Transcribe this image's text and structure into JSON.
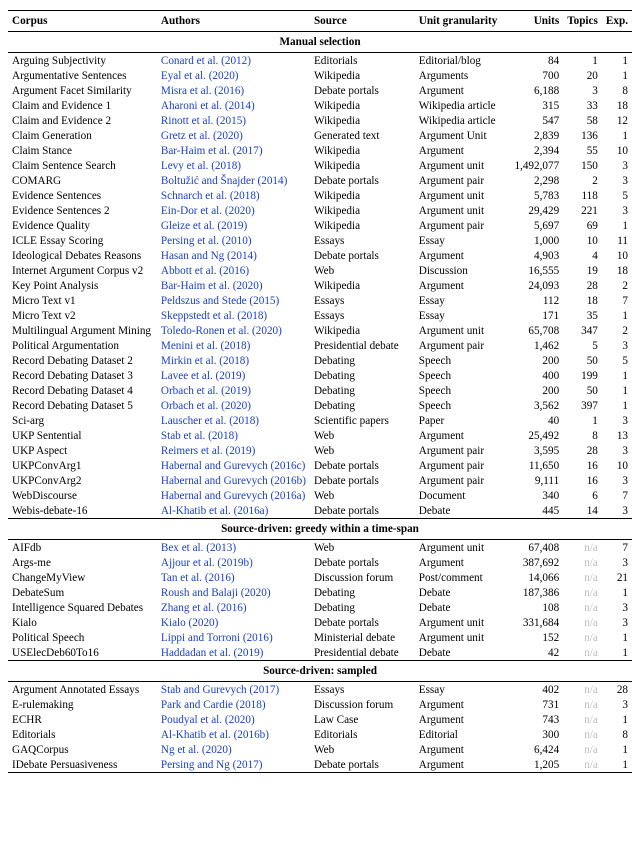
{
  "headers": {
    "corpus": "Corpus",
    "authors": "Authors",
    "source": "Source",
    "granularity": "Unit granularity",
    "units": "Units",
    "topics": "Topics",
    "exp": "Exp."
  },
  "sections": [
    {
      "title": "Manual selection",
      "rows": [
        {
          "corpus": "Arguing Subjectivity",
          "authors": "Conard et al. (2012)",
          "source": "Editorials",
          "gran": "Editorial/blog",
          "units": "84",
          "topics": "1",
          "exp": "1"
        },
        {
          "corpus": "Argumentative Sentences",
          "authors": "Eyal et al. (2020)",
          "source": "Wikipedia",
          "gran": "Arguments",
          "units": "700",
          "topics": "20",
          "exp": "1"
        },
        {
          "corpus": "Argument Facet Similarity",
          "authors": "Misra et al. (2016)",
          "source": "Debate portals",
          "gran": "Argument",
          "units": "6,188",
          "topics": "3",
          "exp": "8"
        },
        {
          "corpus": "Claim and Evidence 1",
          "authors": "Aharoni et al. (2014)",
          "source": "Wikipedia",
          "gran": "Wikipedia article",
          "units": "315",
          "topics": "33",
          "exp": "18"
        },
        {
          "corpus": "Claim and Evidence 2",
          "authors": "Rinott et al. (2015)",
          "source": "Wikipedia",
          "gran": "Wikipedia article",
          "units": "547",
          "topics": "58",
          "exp": "12"
        },
        {
          "corpus": "Claim Generation",
          "authors": "Gretz et al. (2020)",
          "source": "Generated text",
          "gran": "Argument Unit",
          "units": "2,839",
          "topics": "136",
          "exp": "1"
        },
        {
          "corpus": "Claim Stance",
          "authors": "Bar-Haim et al. (2017)",
          "source": "Wikipedia",
          "gran": "Argument",
          "units": "2,394",
          "topics": "55",
          "exp": "10"
        },
        {
          "corpus": "Claim Sentence Search",
          "authors": "Levy et al. (2018)",
          "source": "Wikipedia",
          "gran": "Argument unit",
          "units": "1,492,077",
          "topics": "150",
          "exp": "3"
        },
        {
          "corpus": "COMARG",
          "authors": "Boltužić and Šnajder (2014)",
          "source": "Debate portals",
          "gran": "Argument pair",
          "units": "2,298",
          "topics": "2",
          "exp": "3"
        },
        {
          "corpus": "Evidence Sentences",
          "authors": "Schnarch et al. (2018)",
          "source": "Wikipedia",
          "gran": "Argument unit",
          "units": "5,783",
          "topics": "118",
          "exp": "5"
        },
        {
          "corpus": "Evidence Sentences 2",
          "authors": "Ein-Dor et al. (2020)",
          "source": "Wikipedia",
          "gran": "Argument unit",
          "units": "29,429",
          "topics": "221",
          "exp": "3"
        },
        {
          "corpus": "Evidence Quality",
          "authors": "Gleize et al. (2019)",
          "source": "Wikipedia",
          "gran": "Argument pair",
          "units": "5,697",
          "topics": "69",
          "exp": "1"
        },
        {
          "corpus": "ICLE Essay Scoring",
          "authors": "Persing et al. (2010)",
          "source": "Essays",
          "gran": "Essay",
          "units": "1,000",
          "topics": "10",
          "exp": "11"
        },
        {
          "corpus": "Ideological Debates Reasons",
          "authors": "Hasan and Ng (2014)",
          "source": "Debate portals",
          "gran": "Argument",
          "units": "4,903",
          "topics": "4",
          "exp": "10"
        },
        {
          "corpus": "Internet Argument Corpus v2",
          "authors": "Abbott et al. (2016)",
          "source": "Web",
          "gran": "Discussion",
          "units": "16,555",
          "topics": "19",
          "exp": "18"
        },
        {
          "corpus": "Key Point Analysis",
          "authors": "Bar-Haim et al. (2020)",
          "source": "Wikipedia",
          "gran": "Argument",
          "units": "24,093",
          "topics": "28",
          "exp": "2"
        },
        {
          "corpus": "Micro Text v1",
          "authors": "Peldszus and Stede (2015)",
          "source": "Essays",
          "gran": "Essay",
          "units": "112",
          "topics": "18",
          "exp": "7"
        },
        {
          "corpus": "Micro Text v2",
          "authors": "Skeppstedt et al. (2018)",
          "source": "Essays",
          "gran": "Essay",
          "units": "171",
          "topics": "35",
          "exp": "1"
        },
        {
          "corpus": "Multilingual Argument Mining",
          "authors": "Toledo-Ronen et al. (2020)",
          "source": "Wikipedia",
          "gran": "Argument unit",
          "units": "65,708",
          "topics": "347",
          "exp": "2"
        },
        {
          "corpus": "Political Argumentation",
          "authors": "Menini et al. (2018)",
          "source": "Presidential debate",
          "gran": "Argument pair",
          "units": "1,462",
          "topics": "5",
          "exp": "3"
        },
        {
          "corpus": "Record Debating Dataset 2",
          "authors": "Mirkin et al. (2018)",
          "source": "Debating",
          "gran": "Speech",
          "units": "200",
          "topics": "50",
          "exp": "5"
        },
        {
          "corpus": "Record Debating Dataset 3",
          "authors": "Lavee et al. (2019)",
          "source": "Debating",
          "gran": "Speech",
          "units": "400",
          "topics": "199",
          "exp": "1"
        },
        {
          "corpus": "Record Debating Dataset 4",
          "authors": "Orbach et al. (2019)",
          "source": "Debating",
          "gran": "Speech",
          "units": "200",
          "topics": "50",
          "exp": "1"
        },
        {
          "corpus": "Record Debating Dataset 5",
          "authors": "Orbach et al. (2020)",
          "source": "Debating",
          "gran": "Speech",
          "units": "3,562",
          "topics": "397",
          "exp": "1"
        },
        {
          "corpus": "Sci-arg",
          "authors": "Lauscher et al. (2018)",
          "source": "Scientific papers",
          "gran": "Paper",
          "units": "40",
          "topics": "1",
          "exp": "3"
        },
        {
          "corpus": "UKP Sentential",
          "authors": "Stab et al. (2018)",
          "source": "Web",
          "gran": "Argument",
          "units": "25,492",
          "topics": "8",
          "exp": "13"
        },
        {
          "corpus": "UKP Aspect",
          "authors": "Reimers et al. (2019)",
          "source": "Web",
          "gran": "Argument pair",
          "units": "3,595",
          "topics": "28",
          "exp": "3"
        },
        {
          "corpus": "UKPConvArg1",
          "authors": "Habernal and Gurevych (2016c)",
          "source": "Debate portals",
          "gran": "Argument pair",
          "units": "11,650",
          "topics": "16",
          "exp": "10"
        },
        {
          "corpus": "UKPConvArg2",
          "authors": "Habernal and Gurevych (2016b)",
          "source": "Debate portals",
          "gran": "Argument pair",
          "units": "9,111",
          "topics": "16",
          "exp": "3"
        },
        {
          "corpus": "WebDiscourse",
          "authors": "Habernal and Gurevych (2016a)",
          "source": "Web",
          "gran": "Document",
          "units": "340",
          "topics": "6",
          "exp": "7"
        },
        {
          "corpus": "Webis-debate-16",
          "authors": "Al-Khatib et al. (2016a)",
          "source": "Debate portals",
          "gran": "Debate",
          "units": "445",
          "topics": "14",
          "exp": "3"
        }
      ]
    },
    {
      "title": "Source-driven: greedy within a time-span",
      "rows": [
        {
          "corpus": "AIFdb",
          "authors": "Bex et al. (2013)",
          "source": "Web",
          "gran": "Argument unit",
          "units": "67,408",
          "topics": "n/a",
          "exp": "7"
        },
        {
          "corpus": "Args-me",
          "authors": "Ajjour et al. (2019b)",
          "source": "Debate portals",
          "gran": "Argument",
          "units": "387,692",
          "topics": "n/a",
          "exp": "3"
        },
        {
          "corpus": "ChangeMyView",
          "authors": "Tan et al. (2016)",
          "source": "Discussion forum",
          "gran": "Post/comment",
          "units": "14,066",
          "topics": "n/a",
          "exp": "21"
        },
        {
          "corpus": "DebateSum",
          "authors": "Roush and Balaji (2020)",
          "source": "Debating",
          "gran": "Debate",
          "units": "187,386",
          "topics": "n/a",
          "exp": "1"
        },
        {
          "corpus": "Intelligence Squared Debates",
          "authors": "Zhang et al. (2016)",
          "source": "Debating",
          "gran": "Debate",
          "units": "108",
          "topics": "n/a",
          "exp": "3"
        },
        {
          "corpus": "Kialo",
          "authors": "Kialo (2020)",
          "source": "Debate portals",
          "gran": "Argument unit",
          "units": "331,684",
          "topics": "n/a",
          "exp": "3"
        },
        {
          "corpus": "Political Speech",
          "authors": "Lippi and Torroni (2016)",
          "source": "Ministerial debate",
          "gran": "Argument unit",
          "units": "152",
          "topics": "n/a",
          "exp": "1"
        },
        {
          "corpus": "USElecDeb60To16",
          "authors": "Haddadan et al. (2019)",
          "source": "Presidential debate",
          "gran": "Debate",
          "units": "42",
          "topics": "n/a",
          "exp": "1"
        }
      ]
    },
    {
      "title": "Source-driven: sampled",
      "rows": [
        {
          "corpus": "Argument Annotated Essays",
          "authors": "Stab and Gurevych (2017)",
          "source": "Essays",
          "gran": "Essay",
          "units": "402",
          "topics": "n/a",
          "exp": "28"
        },
        {
          "corpus": "E-rulemaking",
          "authors": "Park and Cardie (2018)",
          "source": "Discussion forum",
          "gran": "Argument",
          "units": "731",
          "topics": "n/a",
          "exp": "3"
        },
        {
          "corpus": "ECHR",
          "authors": "Poudyal et al. (2020)",
          "source": "Law Case",
          "gran": "Argument",
          "units": "743",
          "topics": "n/a",
          "exp": "1"
        },
        {
          "corpus": "Editorials",
          "authors": "Al-Khatib et al. (2016b)",
          "source": "Editorials",
          "gran": "Editorial",
          "units": "300",
          "topics": "n/a",
          "exp": "8"
        },
        {
          "corpus": "GAQCorpus",
          "authors": "Ng et al. (2020)",
          "source": "Web",
          "gran": "Argument",
          "units": "6,424",
          "topics": "n/a",
          "exp": "1"
        },
        {
          "corpus": "IDebate Persuasiveness",
          "authors": "Persing and Ng (2017)",
          "source": "Debate portals",
          "gran": "Argument",
          "units": "1,205",
          "topics": "n/a",
          "exp": "1"
        }
      ]
    }
  ]
}
